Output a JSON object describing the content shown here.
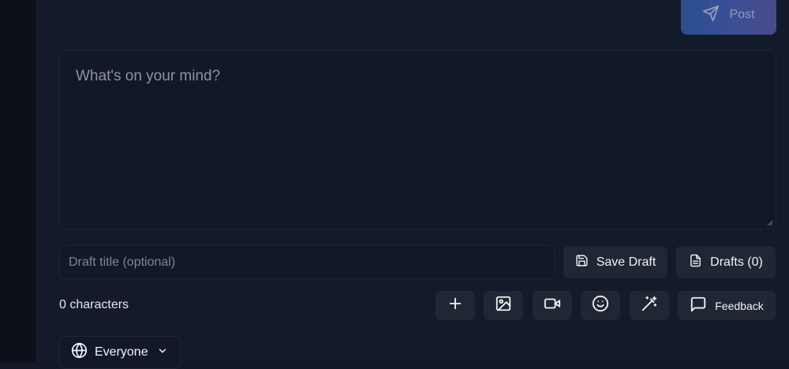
{
  "post_button": {
    "label": "Post",
    "icon": "send-icon"
  },
  "composer": {
    "placeholder": "What's on your mind?",
    "value": ""
  },
  "draft": {
    "title_placeholder": "Draft title (optional)",
    "save_label": "Save Draft",
    "drafts_label": "Drafts (0)"
  },
  "stats": {
    "characters": "0 characters"
  },
  "toolbar": {
    "tools": [
      "plus-icon",
      "image-icon",
      "video-icon",
      "smile-icon",
      "magic-wand-icon"
    ],
    "feedback_label": "Feedback"
  },
  "audience": {
    "label": "Everyone",
    "icon": "globe-icon"
  }
}
